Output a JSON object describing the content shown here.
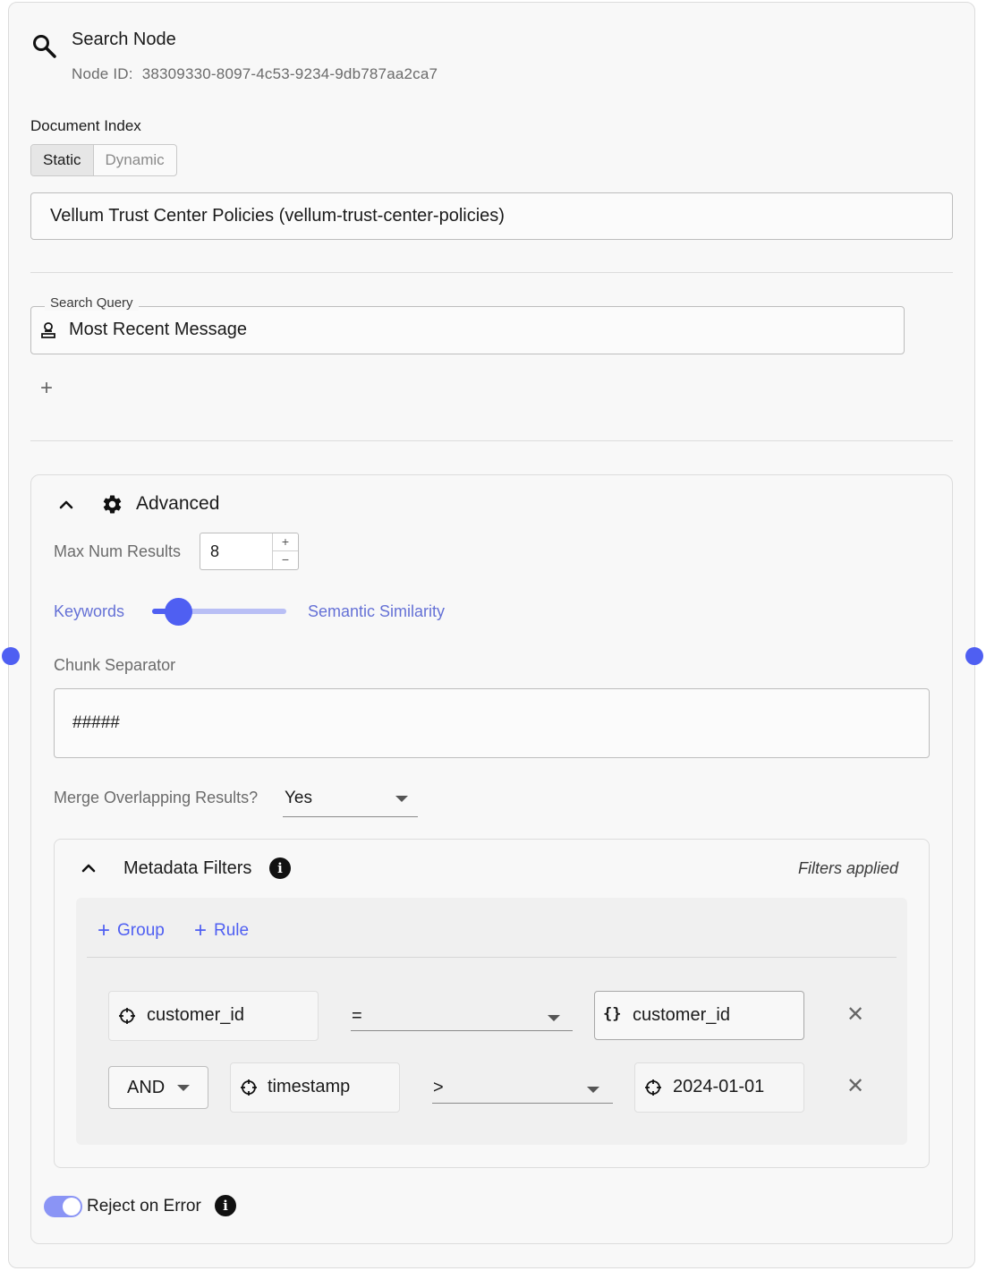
{
  "header": {
    "title": "Search Node",
    "node_id_label": "Node ID:",
    "node_id_value": "38309330-8097-4c53-9234-9db787aa2ca7"
  },
  "document_index": {
    "label": "Document Index",
    "modes": [
      "Static",
      "Dynamic"
    ],
    "active_mode": "Static",
    "selected_value": "Vellum Trust Center Policies (vellum-trust-center-policies)"
  },
  "search_query": {
    "legend": "Search Query",
    "value": "Most Recent Message",
    "add_symbol": "+"
  },
  "advanced": {
    "title": "Advanced",
    "max_num_results_label": "Max Num Results",
    "max_num_results_value": "8",
    "stepper_up": "+",
    "stepper_down": "−",
    "slider_left_label": "Keywords",
    "slider_right_label": "Semantic Similarity",
    "slider_value_fraction": 0.1,
    "chunk_separator_label": "Chunk Separator",
    "chunk_separator_value": "#####",
    "merge_label": "Merge Overlapping Results?",
    "merge_value": "Yes"
  },
  "metadata_filters": {
    "title": "Metadata Filters",
    "status": "Filters applied",
    "add_group_label": "Group",
    "add_rule_label": "Rule",
    "rules": [
      {
        "field": "customer_id",
        "operator": "=",
        "value": "customer_id",
        "value_type": "variable"
      },
      {
        "connector": "AND",
        "field": "timestamp",
        "operator": ">",
        "value": "2024-01-01",
        "value_type": "constant"
      }
    ],
    "remove_symbol": "✕"
  },
  "reject_on_error": {
    "label": "Reject on Error",
    "enabled": true
  },
  "colors": {
    "accent": "#4f5ff2",
    "accent_light": "#8a94f5",
    "link_text": "#6571d6"
  }
}
